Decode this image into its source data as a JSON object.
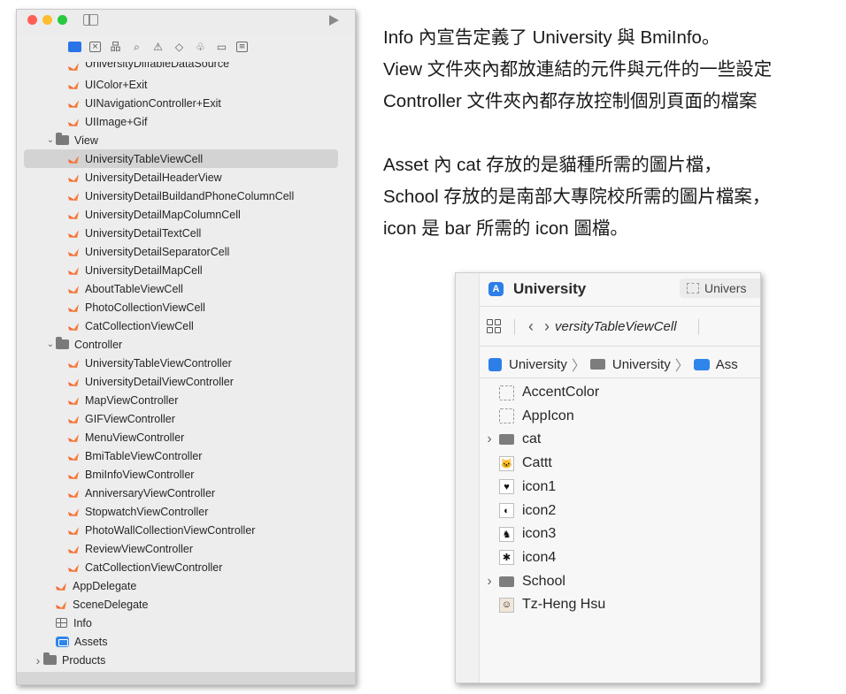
{
  "navigator": {
    "toolbar_icons": [
      "folder-icon",
      "source-control-icon",
      "hierarchy-icon",
      "search-icon",
      "warning-icon",
      "test-diamond-icon",
      "debug-spray-icon",
      "breakpoint-icon",
      "report-icon"
    ],
    "items": [
      {
        "label": "UniversityDiffableDataSource",
        "type": "swift",
        "indent": 2,
        "partial": true
      },
      {
        "label": "UIColor+Exit",
        "type": "swift",
        "indent": 2
      },
      {
        "label": "UINavigationController+Exit",
        "type": "swift",
        "indent": 2
      },
      {
        "label": "UIImage+Gif",
        "type": "swift",
        "indent": 2
      },
      {
        "label": "View",
        "type": "folder",
        "indent": 1,
        "expanded": true
      },
      {
        "label": "UniversityTableViewCell",
        "type": "swift",
        "indent": 2,
        "selected": true
      },
      {
        "label": "UniversityDetailHeaderView",
        "type": "swift",
        "indent": 2
      },
      {
        "label": "UniversityDetailBuildandPhoneColumnCell",
        "type": "swift",
        "indent": 2
      },
      {
        "label": "UniversityDetailMapColumnCell",
        "type": "swift",
        "indent": 2
      },
      {
        "label": "UniversityDetailTextCell",
        "type": "swift",
        "indent": 2
      },
      {
        "label": "UniversityDetailSeparatorCell",
        "type": "swift",
        "indent": 2
      },
      {
        "label": "UniversityDetailMapCell",
        "type": "swift",
        "indent": 2
      },
      {
        "label": "AboutTableViewCell",
        "type": "swift",
        "indent": 2
      },
      {
        "label": "PhotoCollectionViewCell",
        "type": "swift",
        "indent": 2
      },
      {
        "label": "CatCollectionViewCell",
        "type": "swift",
        "indent": 2
      },
      {
        "label": "Controller",
        "type": "folder",
        "indent": 1,
        "expanded": true
      },
      {
        "label": "UniversityTableViewController",
        "type": "swift",
        "indent": 2
      },
      {
        "label": "UniversityDetailViewController",
        "type": "swift",
        "indent": 2
      },
      {
        "label": "MapViewController",
        "type": "swift",
        "indent": 2
      },
      {
        "label": "GIFViewController",
        "type": "swift",
        "indent": 2
      },
      {
        "label": "MenuViewController",
        "type": "swift",
        "indent": 2
      },
      {
        "label": "BmiTableViewController",
        "type": "swift",
        "indent": 2
      },
      {
        "label": "BmiInfoViewController",
        "type": "swift",
        "indent": 2
      },
      {
        "label": "AnniversaryViewController",
        "type": "swift",
        "indent": 2
      },
      {
        "label": "StopwatchViewController",
        "type": "swift",
        "indent": 2
      },
      {
        "label": "PhotoWallCollectionViewController",
        "type": "swift",
        "indent": 2
      },
      {
        "label": "ReviewViewController",
        "type": "swift",
        "indent": 2
      },
      {
        "label": "CatCollectionViewController",
        "type": "swift",
        "indent": 2
      },
      {
        "label": "AppDelegate",
        "type": "swift",
        "indent": 1
      },
      {
        "label": "SceneDelegate",
        "type": "swift",
        "indent": 1
      },
      {
        "label": "Info",
        "type": "plist",
        "indent": 1
      },
      {
        "label": "Assets",
        "type": "assets",
        "indent": 1
      },
      {
        "label": "Products",
        "type": "folder",
        "indent": 0,
        "expanded": false
      }
    ]
  },
  "description": {
    "lines": [
      "Info 內宣告定義了 University 與  BmiInfo。",
      "View 文件夾內都放連結的元件與元件的一些設定",
      "Controller 文件夾內都存放控制個別頁面的檔案",
      "",
      "Asset 內 cat 存放的是貓種所需的圖片檔，",
      "School 存放的是南部大專院校所需的圖片檔案，",
      "icon 是 bar 所需的 icon 圖檔。"
    ]
  },
  "assets_panel": {
    "title": "University",
    "tab_label": "Univers",
    "jump_file": "versityTableViewCell",
    "breadcrumb": [
      "University",
      "University",
      "Ass"
    ],
    "items": [
      {
        "label": "AccentColor",
        "icon": "color-set-icon",
        "chevron": false
      },
      {
        "label": "AppIcon",
        "icon": "app-icon-set-icon",
        "chevron": false
      },
      {
        "label": "cat",
        "icon": "folder-icon",
        "chevron": true
      },
      {
        "label": "Cattt",
        "icon": "cat-thumbnail-icon",
        "chevron": false
      },
      {
        "label": "icon1",
        "icon": "icon1-thumbnail-icon",
        "chevron": false
      },
      {
        "label": "icon2",
        "icon": "icon2-thumbnail-icon",
        "chevron": false
      },
      {
        "label": "icon3",
        "icon": "icon3-thumbnail-icon",
        "chevron": false
      },
      {
        "label": "icon4",
        "icon": "icon4-thumbnail-icon",
        "chevron": false
      },
      {
        "label": "School",
        "icon": "folder-icon",
        "chevron": true
      },
      {
        "label": "Tz-Heng Hsu",
        "icon": "person-thumbnail-icon",
        "chevron": false
      }
    ]
  },
  "colors": {
    "swift_orange": "#f05138",
    "xcode_blue": "#2e7ee8",
    "selection_gray": "#d3d3d3"
  }
}
